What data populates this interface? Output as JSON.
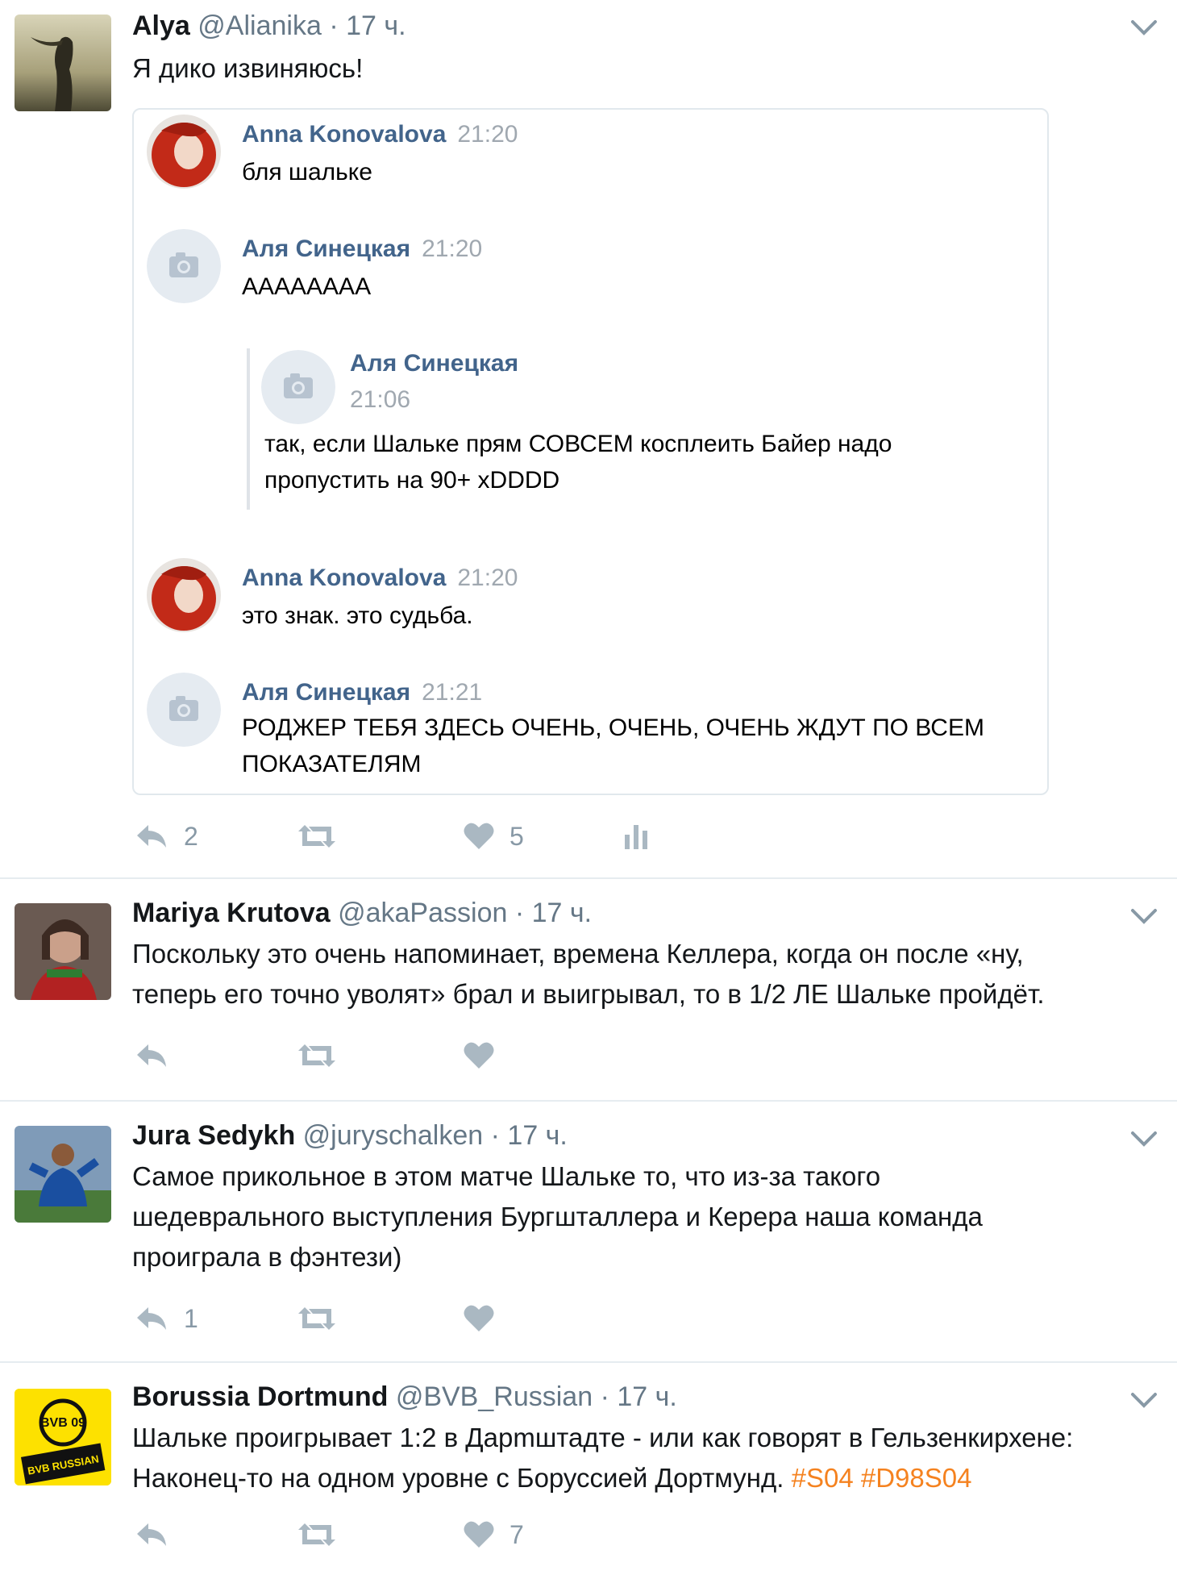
{
  "tweets": [
    {
      "name": "Alya",
      "handle": "@Alianika",
      "time": "17 ч.",
      "text": "Я дико извиняюсь!",
      "vk_messages": [
        {
          "author": "Anna Konovalova",
          "time": "21:20",
          "text": "бля шальке",
          "avatar": "red-hair-photo"
        },
        {
          "author": "Аля Синецкая",
          "time": "21:20",
          "text": "АААААААА",
          "avatar": "camera-icon"
        },
        {
          "author": "Аля Синецкая",
          "time": "21:06",
          "text": "так, если Шальке прям СОВСЕМ косплеить Байер надо\nпропустить на 90+ xDDDD",
          "avatar": "camera-icon",
          "forwarded": true
        },
        {
          "author": "Anna Konovalova",
          "time": "21:20",
          "text": "это знак. это судьба.",
          "avatar": "red-hair-photo"
        },
        {
          "author": "Аля Синецкая",
          "time": "21:21",
          "text": "РОДЖЕР ТЕБЯ ЗДЕСЬ ОЧЕНЬ, ОЧЕНЬ, ОЧЕНЬ ЖДУТ ПО ВСЕМ\nПОКАЗАТЕЛЯМ",
          "avatar": "camera-icon"
        }
      ],
      "replies": "2",
      "likes": "5"
    },
    {
      "name": "Mariya Krutova",
      "handle": "@akaPassion",
      "time": "17 ч.",
      "text": "Поскольку это очень напоминает, времена Келлера, когда он после «ну,\nтеперь его точно уволят» брал и выигрывал, то в 1/2 ЛЕ Шальке пройдёт."
    },
    {
      "name": "Jura Sedykh",
      "handle": "@juryschalken",
      "time": "17 ч.",
      "text": "Самое прикольное в этом матче Шальке то, что из-за такого\nшедеврального выступления Бургшталлера и Керера наша команда\nпроиграла в фэнтези)",
      "replies": "1"
    },
    {
      "name": "Borussia Dortmund",
      "handle": "@BVB_Russian",
      "time": "17 ч.",
      "text": "Шальке проигрывает 1:2 в Дарmштадте - или как говорят в Гельзенкирхене:\nНаконец-то на одном уровне с Боруссией Дортмунд.",
      "hashtags": "#S04 #D98S04",
      "likes": "7",
      "logo_text": "BVB RUSSIAN",
      "logo_mark": "BVB 09"
    }
  ],
  "colors": {
    "name": "#14171a",
    "meta": "#657786",
    "vk_name": "#42648b",
    "hashtag": "#f5821f",
    "action_icon": "#aab8c2",
    "bvb_yellow": "#fde100"
  },
  "dot": "·"
}
